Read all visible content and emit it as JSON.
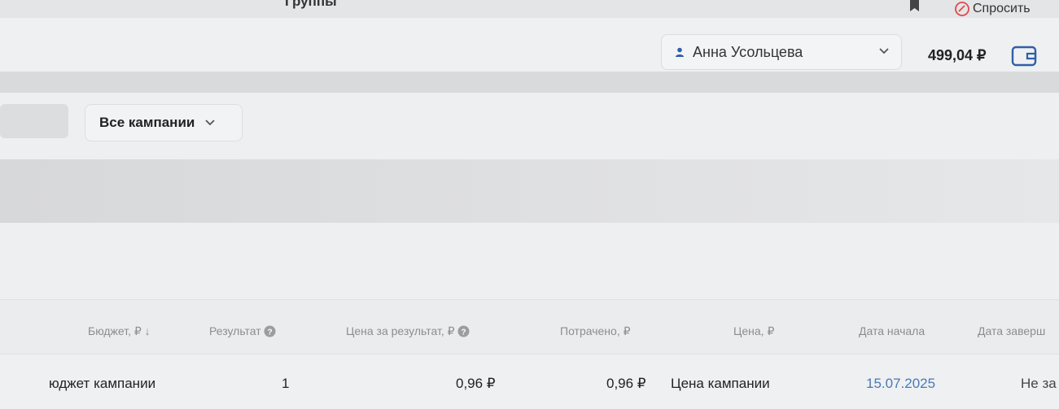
{
  "header": {
    "tab_label": "Группы",
    "ask_label": "Спросить"
  },
  "account": {
    "user_name": "Анна Усольцева",
    "balance": "499,04 ₽"
  },
  "filters": {
    "campaign_filter": "Все кампании"
  },
  "table": {
    "columns": [
      "Бюджет, ₽ ↓",
      "Результат",
      "Цена за результат, ₽",
      "Потрачено, ₽",
      "Цена, ₽",
      "Дата начала",
      "Дата заверш"
    ],
    "rows": [
      {
        "budget": "юджет кампании",
        "result": "1",
        "cost_per_result": "0,96 ₽",
        "spent": "0,96 ₽",
        "price": "Цена кампании",
        "start_date": "15.07.2025",
        "end_date": "Не за"
      }
    ]
  },
  "colors": {
    "accent_blue": "#2f5fa8",
    "ask_red": "#e0484d",
    "date_link": "#4a78b8"
  }
}
